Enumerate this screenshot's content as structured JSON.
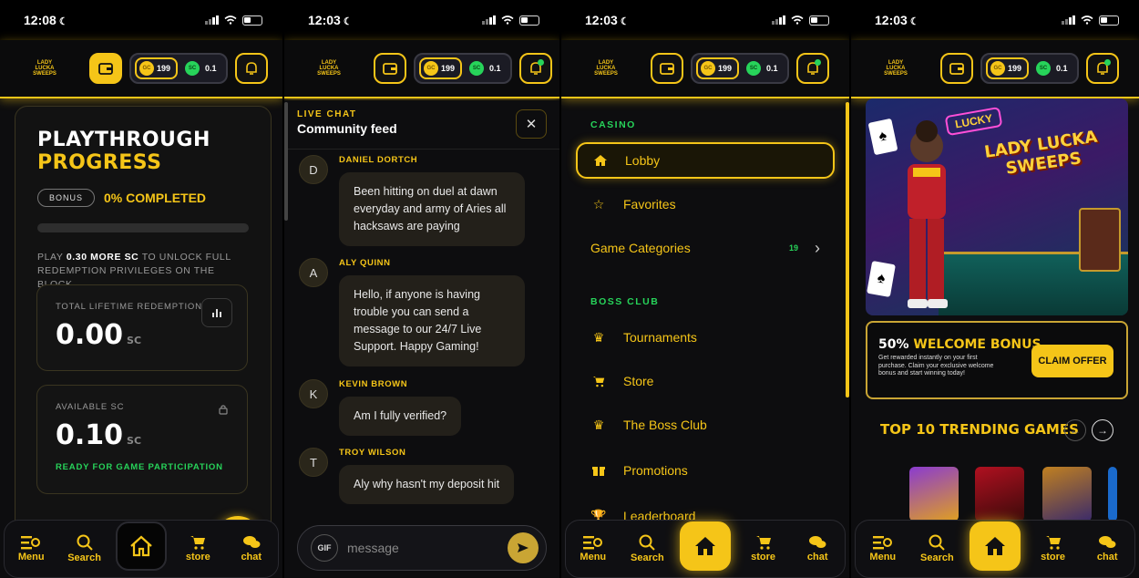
{
  "status_times": [
    "12:08",
    "12:03",
    "12:03",
    "12:03"
  ],
  "header": {
    "logo_text": "LADY LUCKA SWEEPS",
    "gc_coin": "GC",
    "gc_amount": "199",
    "sc_coin": "SC",
    "sc_amount": "0.1"
  },
  "bottom_nav": {
    "menu": "Menu",
    "search": "Search",
    "store": "store",
    "chat": "chat"
  },
  "playthrough": {
    "title_white": "PLAYTHROUGH",
    "title_yellow": "PROGRESS",
    "bonus_badge": "BONUS",
    "completed": "0% COMPLETED",
    "progress_fraction": 0.0,
    "note_prefix": "PLAY",
    "note_amount": "0.30 MORE SC",
    "note_suffix": "TO UNLOCK FULL REDEMPTION PRIVILEGES ON THE BLOCK.",
    "lifetime_label": "TOTAL LIFETIME REDEMPTION",
    "lifetime_value": "0.00",
    "lifetime_unit": "SC",
    "available_label": "AVAILABLE SC",
    "available_value": "0.10",
    "available_unit": "SC",
    "ready_text": "READY FOR GAME PARTICIPATION"
  },
  "chat": {
    "kicker": "LIVE CHAT",
    "title": "Community feed",
    "messages": [
      {
        "initial": "D",
        "name": "DANIEL DORTCH",
        "text": "Been hitting on duel at dawn everyday and army of Aries all hacksaws are paying"
      },
      {
        "initial": "A",
        "name": "ALY QUINN",
        "text": "Hello, if anyone is having trouble you can send a message to our 24/7 Live Support. Happy Gaming!"
      },
      {
        "initial": "K",
        "name": "KEVIN BROWN",
        "text": "Am I fully verified?"
      },
      {
        "initial": "T",
        "name": "TROY WILSON",
        "text": "Aly why hasn't my deposit hit"
      }
    ],
    "gif_label": "GIF",
    "input_placeholder": "message"
  },
  "menu": {
    "casino_label": "CASINO",
    "boss_label": "BOSS CLUB",
    "items": [
      {
        "label": "Lobby",
        "icon": "home-icon"
      },
      {
        "label": "Favorites",
        "icon": "star-icon"
      },
      {
        "label": "Game Categories",
        "count": "19"
      },
      {
        "label": "Tournaments",
        "icon": "crown-icon"
      },
      {
        "label": "Store",
        "icon": "cart-icon"
      },
      {
        "label": "The Boss Club",
        "icon": "crown-icon"
      },
      {
        "label": "Promotions",
        "icon": "gift-icon"
      },
      {
        "label": "Leaderboard",
        "icon": "trophy-icon"
      }
    ]
  },
  "lobby": {
    "hero_lucky": "LUCKY",
    "hero_title_1": "LADY LUCKA",
    "hero_title_2": "SWEEPS",
    "welcome_white": "50%",
    "welcome_yellow": "WELCOME BONUS",
    "welcome_desc": "Get rewarded instantly on your first purchase. Claim your exclusive welcome bonus and start winning today!",
    "claim_label": "CLAIM OFFER",
    "trending_title": "TOP 10 TRENDING GAMES"
  },
  "colors": {
    "accent": "#f5c518",
    "green": "#27d35a",
    "bg": "#0d0d0f"
  }
}
